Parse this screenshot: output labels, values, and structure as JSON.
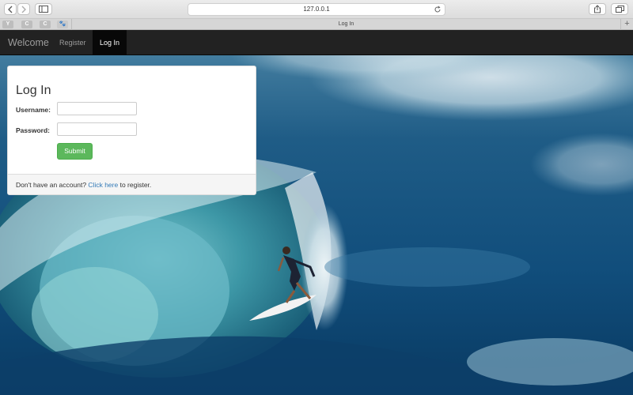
{
  "browser": {
    "url": "127.0.0.1",
    "tab_title": "Log In",
    "favorites": [
      "Y",
      "C",
      "C",
      "🐾"
    ],
    "new_tab": "+"
  },
  "navbar": {
    "brand": "Welcome",
    "links": [
      "Register",
      "Log In"
    ],
    "active": "Log In"
  },
  "login": {
    "title": "Log In",
    "username_label": "Username:",
    "password_label": "Password:",
    "username_value": "",
    "password_value": "",
    "submit_label": "Submit",
    "footer_prefix": "Don't have an account?",
    "footer_link": "Click here",
    "footer_suffix": "to register."
  },
  "colors": {
    "navbar": "#222222",
    "submit": "#5cb85c",
    "link": "#337ab7"
  }
}
